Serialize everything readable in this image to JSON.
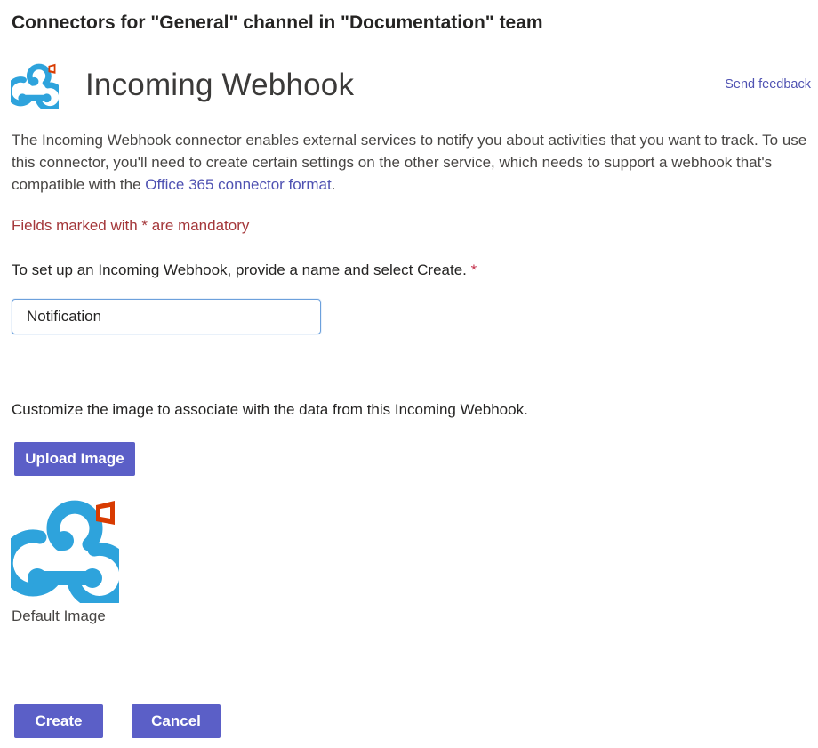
{
  "dialog": {
    "title": "Connectors for \"General\" channel in \"Documentation\" team"
  },
  "connector": {
    "name": "Incoming Webhook",
    "icon": "webhook-icon",
    "badge_icon": "office-icon",
    "feedback_label": "Send feedback",
    "description_text": "The Incoming Webhook connector enables external services to notify you about activities that you want to track. To use this connector, you'll need to create certain settings on the other service, which needs to support a webhook that's compatible with the ",
    "description_link": "Office 365 connector format",
    "description_end": "."
  },
  "form": {
    "mandatory_note": "Fields marked with * are mandatory",
    "setup_label": "To set up an Incoming Webhook, provide a name and select Create.",
    "required_mark": "*",
    "name_value": "Notification",
    "customize_label": "Customize the image to associate with the data from this Incoming Webhook.",
    "upload_label": "Upload Image",
    "default_image_caption": "Default Image"
  },
  "actions": {
    "create_label": "Create",
    "cancel_label": "Cancel"
  },
  "colors": {
    "accent": "#5b5fc7",
    "webhook_blue": "#2ea3dc",
    "office_red": "#d83b01",
    "mandatory_red": "#a4373a",
    "link": "#4f52b2"
  }
}
